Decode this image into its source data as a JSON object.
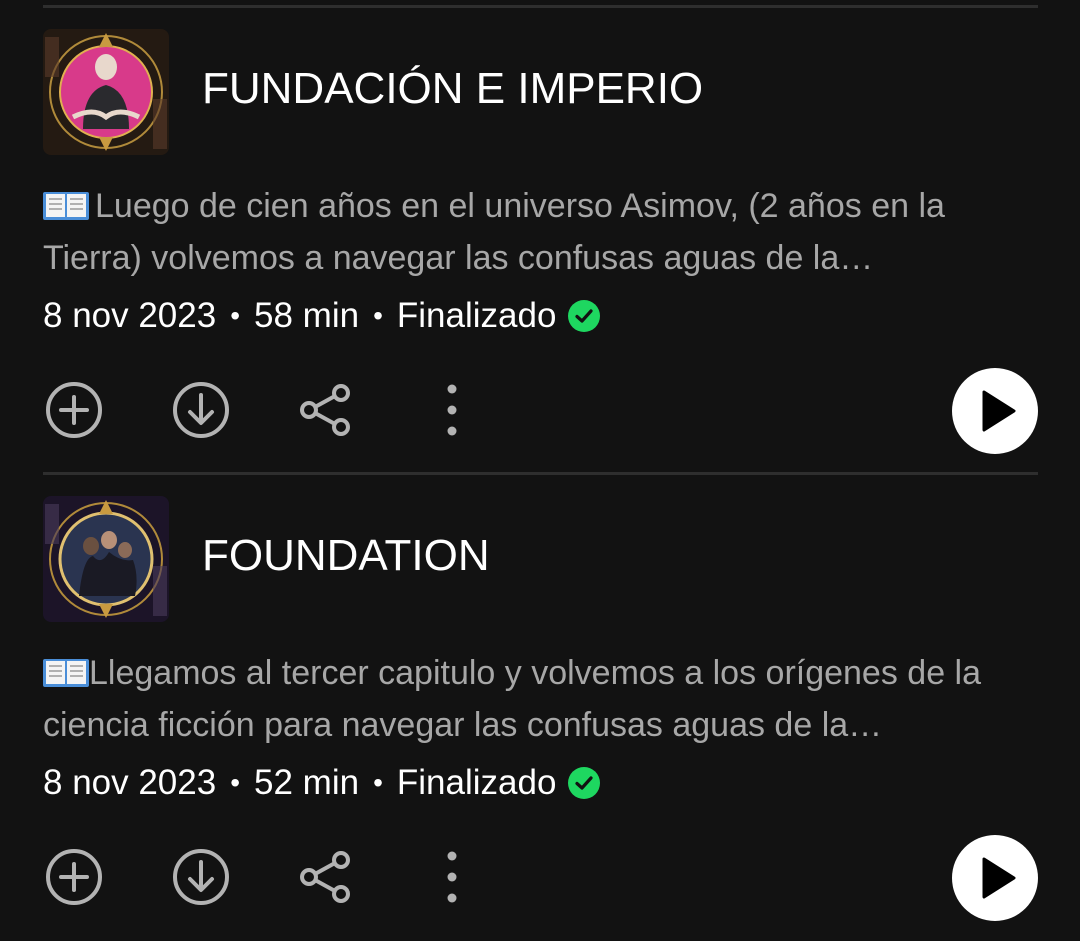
{
  "episodes": [
    {
      "title": "FUNDACIÓN E IMPERIO",
      "description": "Luego de cien años en el universo Asimov, (2 años en la Tierra) volvemos a navegar las confusas aguas de la psicohistoria...",
      "description_icon": "open-book-icon",
      "date": "8 nov 2023",
      "duration": "58 min",
      "status": "Finalizado",
      "status_icon": "check-circle-icon",
      "status_color": "#1ed760",
      "thumbnail_icon": "episode-cover-icon"
    },
    {
      "title": "FOUNDATION",
      "description": "Llegamos al tercer capitulo y volvemos a los orígenes de la ciencia ficción para navegar las confusas aguas de la psicohistoria...",
      "description_icon": "open-book-icon",
      "date": "8 nov 2023",
      "duration": "52 min",
      "status": "Finalizado",
      "status_icon": "check-circle-icon",
      "status_color": "#1ed760",
      "thumbnail_icon": "episode-cover-icon"
    }
  ],
  "separator": "•",
  "action_icons": [
    "add-circle-icon",
    "download-circle-icon",
    "share-icon",
    "more-vertical-icon",
    "play-icon"
  ]
}
